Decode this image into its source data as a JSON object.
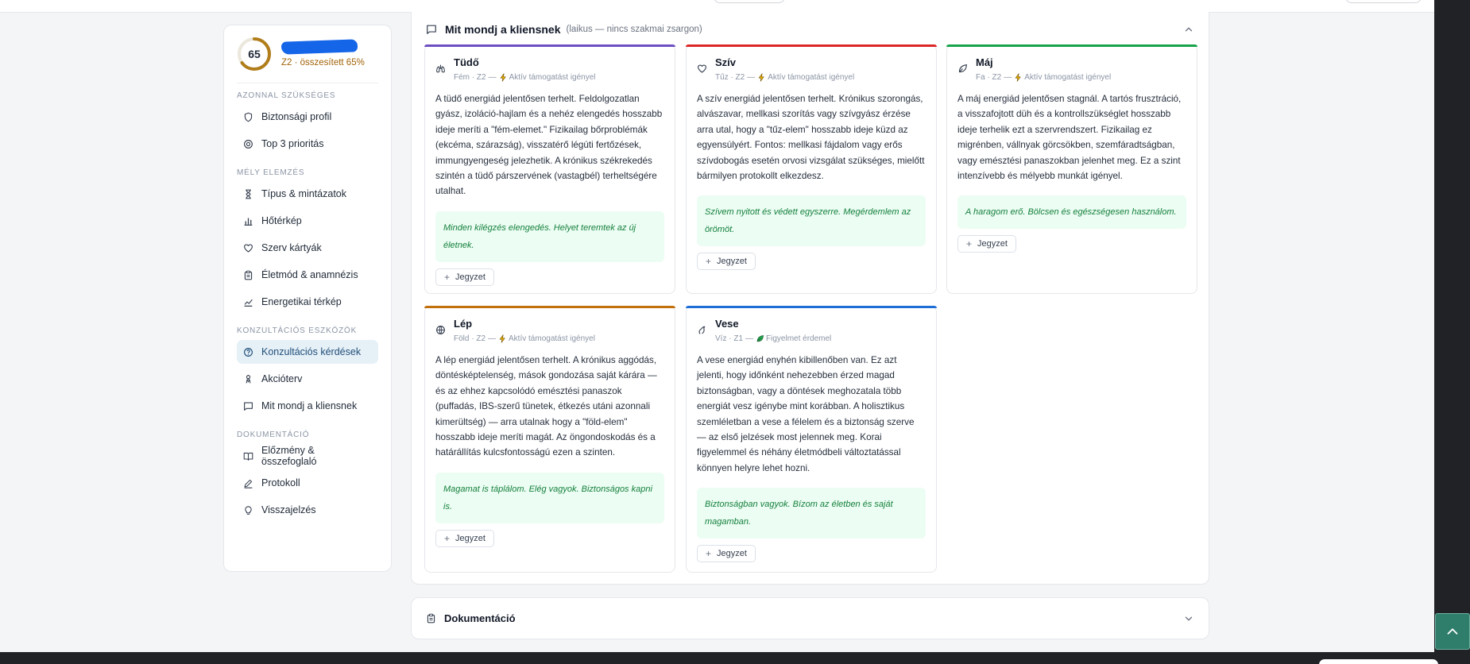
{
  "sidebar": {
    "score": "65",
    "score_fraction": 0.65,
    "score_sub": "Z2 · összesített 65%",
    "sections": [
      {
        "label": "AZONNAL SZÜKSÉGES",
        "items": [
          {
            "label": "Biztonsági profil",
            "icon": "shield-icon"
          },
          {
            "label": "Top 3 prioritás",
            "icon": "target-icon"
          }
        ]
      },
      {
        "label": "MÉLY ELEMZÉS",
        "items": [
          {
            "label": "Típus & mintázatok",
            "icon": "hourglass-icon"
          },
          {
            "label": "Hőtérkép",
            "icon": "bar-chart-icon"
          },
          {
            "label": "Szerv kártyák",
            "icon": "heart-icon"
          },
          {
            "label": "Életmód & anamnézis",
            "icon": "clipboard-icon"
          },
          {
            "label": "Energetikai térkép",
            "icon": "trend-icon"
          }
        ]
      },
      {
        "label": "KONZULTÁCIÓS ESZKÖZÖK",
        "items": [
          {
            "label": "Konzultációs kérdések",
            "icon": "question-circle-icon",
            "active": true
          },
          {
            "label": "Akcióterv",
            "icon": "person-icon"
          },
          {
            "label": "Mit mondj a kliensnek",
            "icon": "message-square-icon"
          }
        ]
      },
      {
        "label": "DOKUMENTÁCIÓ",
        "items": [
          {
            "label": "Előzmény & összefoglaló",
            "icon": "book-icon"
          },
          {
            "label": "Protokoll",
            "icon": "pen-icon"
          },
          {
            "label": "Visszajelzés",
            "icon": "lightbulb-icon"
          }
        ]
      }
    ]
  },
  "panel": {
    "title": "Mit mondj a kliensnek",
    "subtitle": "(laikus — nincs szakmai zsargon)"
  },
  "cards": [
    {
      "name": "Tüdő",
      "element": "Fém · Z2",
      "status": "Aktív támogatást igényel",
      "status_icon": "lightning-icon",
      "color": "#6d4fc2",
      "icon": "lungs-icon",
      "text": "A tüdő energiád jelentősen terhelt. Feldolgozatlan gyász, izoláció-hajlam és a nehéz elengedés hosszabb ideje meríti a \"fém-elemet.\" Fizikailag bőrproblémák (ekcéma, szárazság), visszatérő légúti fertőzések, immungyengeség jelezhetik. A krónikus székrekedés szintén a tüdő párszervének (vastagbél) terheltségére utalhat.",
      "affirmation": "Minden kilégzés elengedés. Helyet teremtek az új életnek.",
      "note": "Jegyzet"
    },
    {
      "name": "Szív",
      "element": "Tűz · Z2",
      "status": "Aktív támogatást igényel",
      "status_icon": "lightning-icon",
      "color": "#dc2626",
      "icon": "heart-icon",
      "text": "A szív energiád jelentősen terhelt. Krónikus szorongás, alvászavar, mellkasi szorítás vagy szívgyász érzése arra utal, hogy a \"tűz-elem\" hosszabb ideje küzd az egyensúlyért. Fontos: mellkasi fájdalom vagy erős szívdobogás esetén orvosi vizsgálat szükséges, mielőtt bármilyen protokollt elkezdesz.",
      "affirmation": "Szívem nyitott és védett egyszerre. Megérdemlem az örömöt.",
      "note": "Jegyzet"
    },
    {
      "name": "Máj",
      "element": "Fa · Z2",
      "status": "Aktív támogatást igényel",
      "status_icon": "lightning-icon",
      "color": "#16a34a",
      "icon": "leaf-icon",
      "text": "A máj energiád jelentősen stagnál. A tartós frusztráció, a visszafojtott düh és a kontrollszükséglet hosszabb ideje terhelik ezt a szervrendszert. Fizikailag ez migrénben, vállnyak görcsökben, szemfáradtságban, vagy emésztési panaszokban jelenhet meg. Ez a szint intenzívebb és mélyebb munkát igényel.",
      "affirmation": "A haragom erő. Bölcsen és egészségesen használom.",
      "note": "Jegyzet"
    },
    {
      "name": "Lép",
      "element": "Föld · Z2",
      "status": "Aktív támogatást igényel",
      "status_icon": "lightning-icon",
      "color": "#c2700c",
      "icon": "globe-icon",
      "text": "A lép energiád jelentősen terhelt. A krónikus aggódás, döntésképtelenség, mások gondozása saját kárára — és az ehhez kapcsolódó emésztési panaszok (puffadás, IBS-szerű tünetek, étkezés utáni azonnali kimerültség) — arra utalnak hogy a \"föld-elem\" hosszabb ideje meríti magát. Az öngondoskodás és a határállítás kulcsfontosságú ezen a szinten.",
      "affirmation": "Magamat is táplálom. Elég vagyok. Biztonságos kapni is.",
      "note": "Jegyzet"
    },
    {
      "name": "Vese",
      "element": "Víz · Z1",
      "status": "Figyelmet érdemel",
      "status_icon": "leaf-badge-icon",
      "color": "#1d6fd6",
      "icon": "drop-icon",
      "text": "A vese energiád enyhén kibillenőben van. Ez azt jelenti, hogy időnként nehezebben érzed magad biztonságban, vagy a döntések meghozatala több energiát vesz igénybe mint korábban. A holisztikus szemléletban a vese a félelem és a biztonság szerve — az első jelzések most jelennek meg. Korai figyelemmel és néhány életmódbeli változtatással könnyen helyre lehet hozni.",
      "affirmation": "Biztonságban vagyok. Bízom az életben és saját magamban.",
      "note": "Jegyzet"
    }
  ],
  "documentation": {
    "title": "Dokumentáció"
  }
}
